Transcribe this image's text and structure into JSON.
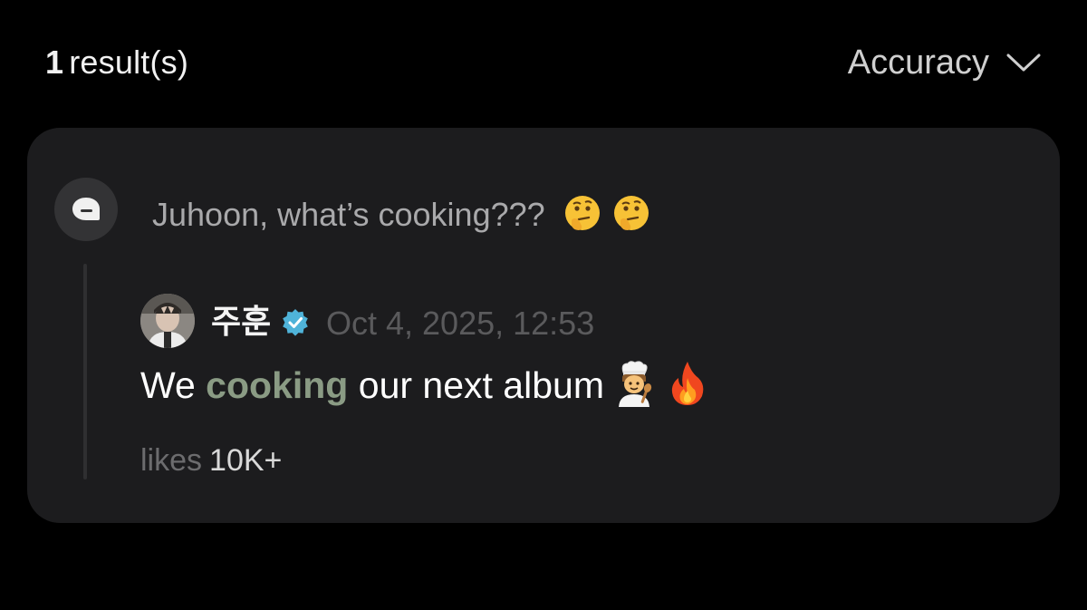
{
  "header": {
    "result_number": "1",
    "result_label": "result(s)",
    "sort_label": "Accuracy"
  },
  "card": {
    "question": "Juhoon, what’s cooking???",
    "question_emojis": [
      "thinking-face-icon",
      "thinking-face-icon"
    ],
    "reply": {
      "author": "주훈",
      "verified": true,
      "timestamp": "Oct 4, 2025, 12:53",
      "text_before": "We",
      "text_highlight": "cooking",
      "text_after": "our next album",
      "emojis": [
        "cook-icon",
        "fire-icon"
      ],
      "likes_label": "likes",
      "likes_value": "10K+"
    }
  },
  "colors": {
    "background": "#000000",
    "card": "#1c1c1e",
    "highlight": "#8a9b84",
    "verified": "#4fb3d9",
    "muted_text": "#a9a9ab"
  }
}
